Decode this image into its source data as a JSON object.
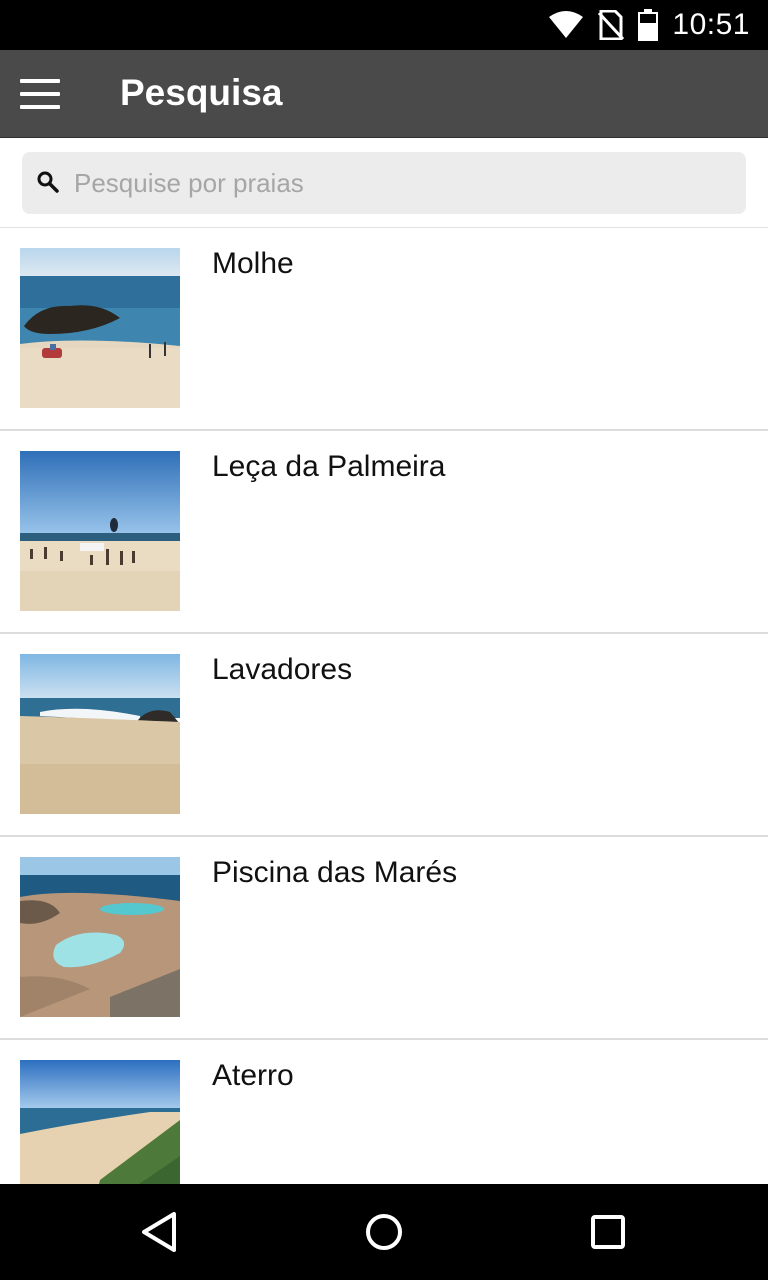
{
  "status_bar": {
    "time": "10:51",
    "icons": [
      "wifi-icon",
      "no-sim-icon",
      "battery-icon"
    ]
  },
  "app_bar": {
    "title": "Pesquisa",
    "menu_icon": "hamburger-menu-icon"
  },
  "search": {
    "placeholder": "Pesquise por praias",
    "value": "",
    "icon": "search-icon"
  },
  "beaches": [
    {
      "name": "Molhe"
    },
    {
      "name": "Leça da Palmeira"
    },
    {
      "name": "Lavadores"
    },
    {
      "name": "Piscina das Marés"
    },
    {
      "name": "Aterro"
    }
  ],
  "nav_bar": {
    "buttons": [
      "back-icon",
      "home-icon",
      "recents-icon"
    ]
  },
  "colors": {
    "app_bar": "#4a4a4a",
    "status_bar": "#000000",
    "search_box": "#ececec"
  }
}
